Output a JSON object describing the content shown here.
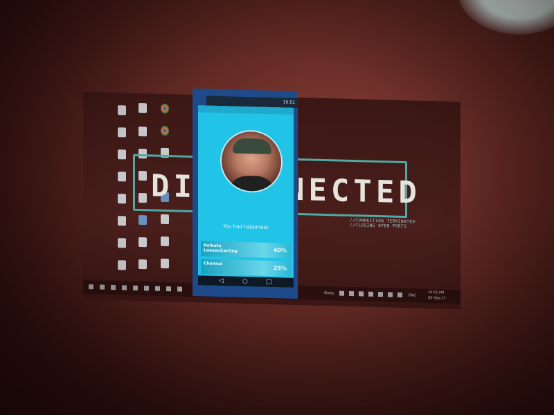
{
  "desktop": {
    "banner_title": "DISCONNECTED",
    "banner_sub": "//CONNECTION TERMINATED\n//CLOSING OPEN PORTS",
    "taskbar": {
      "lang": "ENG",
      "time": "10:51 PM",
      "date": "02-Sep-17",
      "sleep_label": "Sleep"
    }
  },
  "phone": {
    "status_time": "10:51",
    "welcome_text": "You had happiness",
    "stats": [
      {
        "name": "Kolkata\nLoosenCarting",
        "percent": "40%",
        "level": 0.4
      },
      {
        "name": "Chennai",
        "percent": "25%",
        "level": 0.25
      }
    ],
    "nav": {
      "back": "◁",
      "home": "○",
      "recents": "□"
    }
  },
  "colors": {
    "phone_accent": "#21c3e6",
    "banner_border": "#4fa9a4",
    "background": "#5a2520"
  }
}
